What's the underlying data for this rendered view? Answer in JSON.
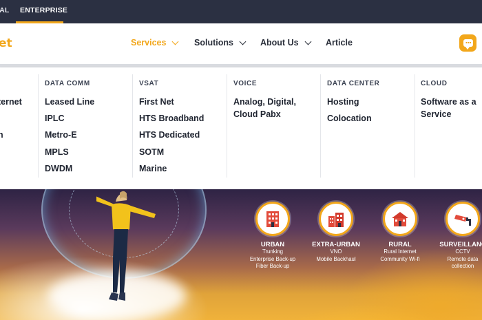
{
  "topbar": {
    "segment_cut": "IAL",
    "segment_active": "ENTERPRISE",
    "accent": "#f2a71b",
    "background": "#2b3042"
  },
  "header": {
    "logo_text": "et",
    "nav": [
      {
        "label": "Services",
        "has_chevron": true,
        "active": true
      },
      {
        "label": "Solutions",
        "has_chevron": true,
        "active": false
      },
      {
        "label": "About Us",
        "has_chevron": true,
        "active": false
      },
      {
        "label": "Article",
        "has_chevron": false,
        "active": false
      }
    ],
    "chat_icon": "chat-bubble-icon"
  },
  "dropdown": {
    "col0": {
      "heading": "",
      "items": [
        "ternet",
        "n"
      ]
    },
    "col1": {
      "heading": "DATA COMM",
      "items": [
        "Leased Line",
        "IPLC",
        "Metro-E",
        "MPLS",
        "DWDM"
      ]
    },
    "col2": {
      "heading": "VSAT",
      "items": [
        "First Net",
        "HTS Broadband",
        "HTS Dedicated",
        "SOTM",
        "Marine"
      ]
    },
    "col3": {
      "heading": "VOICE",
      "items": [
        "Analog, Digital,",
        "Cloud Pabx"
      ]
    },
    "col4": {
      "heading": "DATA CENTER",
      "items": [
        "Hosting",
        "Colocation"
      ]
    },
    "col5": {
      "heading": "CLOUD",
      "items": [
        "Software as a",
        "Service"
      ]
    }
  },
  "hero": {
    "segments": [
      {
        "title": "URBAN",
        "lines": [
          "Trunking",
          "Enterprise Back-up",
          "Fiber Back-up"
        ],
        "icon": "urban-building-icon"
      },
      {
        "title": "EXTRA-URBAN",
        "lines": [
          "VNO",
          "Mobile Backhaul"
        ],
        "icon": "extra-urban-building-icon"
      },
      {
        "title": "RURAL",
        "lines": [
          "Rural Internet",
          "Community Wi-fi"
        ],
        "icon": "rural-house-icon"
      },
      {
        "title": "SURVEILLANC",
        "lines": [
          "CCTV",
          "Remote data",
          "collection"
        ],
        "icon": "cctv-camera-icon"
      }
    ]
  }
}
